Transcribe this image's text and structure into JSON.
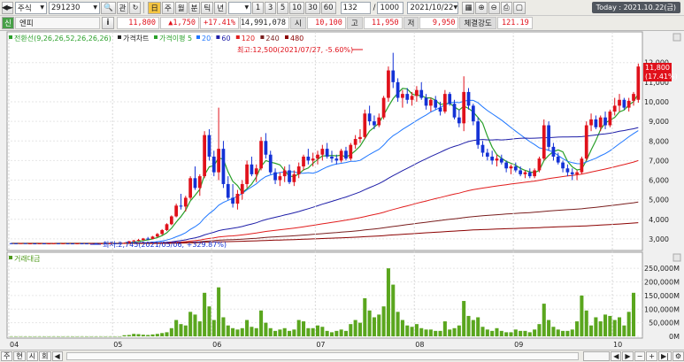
{
  "toolbar": {
    "market_type": "주식",
    "stock_code": "291230",
    "btn_pan": "관",
    "period_buttons": [
      "주",
      "월",
      "분",
      "틱",
      "년"
    ],
    "interval_buttons": [
      "1",
      "3",
      "5",
      "10",
      "30",
      "60"
    ],
    "count_value": "132",
    "total_value": "1000",
    "date_value": "2021/10/22",
    "today_label": "Today : 2021.10.22(금)"
  },
  "quote": {
    "name": "엔피",
    "price": "11,800",
    "change": "▲1,750",
    "change_pct": "+17.41%",
    "volume": "14,991,078",
    "open_label": "시",
    "open": "10,100",
    "high_label": "고",
    "high": "11,950",
    "low_label": "저",
    "low": "9,950",
    "strength_label": "체결강도",
    "strength": "121.19"
  },
  "legend": {
    "ichimoku": "전환선(9,26,26,52,26,26,26)",
    "price_chart": "가격차트",
    "ma_label": "가격이평 5",
    "ma_periods": [
      "20",
      "60",
      "120",
      "240",
      "480"
    ],
    "ma_colors": [
      "#2aa02a",
      "#1f77ff",
      "#1e1ea8",
      "#e11d1d",
      "#7a1e1e",
      "#8b0000"
    ],
    "volume_label": "거래대금"
  },
  "annotations": {
    "high_note": "최고:12,500(2021/07/27, -5.60%)",
    "low_note": "최저:2,745(2021/05/06, +329.87%)",
    "last_price": "11,800",
    "last_pct": "(17.41%)"
  },
  "chart_data": {
    "type": "candlestick",
    "price_axis": [
      "12,000",
      "11,000",
      "10,000",
      "9,000",
      "8,000",
      "7,000",
      "6,000",
      "5,000",
      "4,000",
      "3,000"
    ],
    "price_ylim": [
      2500,
      12800
    ],
    "volume_axis": [
      "250,000M",
      "200,000M",
      "150,000M",
      "100,000M",
      "50,000M",
      "0M"
    ],
    "volume_ylim": [
      0,
      270000
    ],
    "x_ticks": [
      "04",
      "05",
      "06",
      "07",
      "08",
      "09",
      "10"
    ],
    "x_tick_index": [
      0,
      22,
      43,
      65,
      86,
      107,
      128
    ],
    "candles": [
      [
        2780,
        2790,
        2760,
        2775
      ],
      [
        2775,
        2785,
        2760,
        2770
      ],
      [
        2770,
        2790,
        2755,
        2780
      ],
      [
        2780,
        2790,
        2760,
        2765
      ],
      [
        2765,
        2780,
        2750,
        2770
      ],
      [
        2770,
        2785,
        2755,
        2760
      ],
      [
        2760,
        2780,
        2750,
        2772
      ],
      [
        2772,
        2785,
        2755,
        2765
      ],
      [
        2765,
        2780,
        2750,
        2770
      ],
      [
        2770,
        2790,
        2755,
        2775
      ],
      [
        2775,
        2790,
        2760,
        2768
      ],
      [
        2768,
        2785,
        2755,
        2774
      ],
      [
        2774,
        2790,
        2760,
        2770
      ],
      [
        2770,
        2785,
        2755,
        2765
      ],
      [
        2765,
        2780,
        2750,
        2772
      ],
      [
        2772,
        2790,
        2760,
        2770
      ],
      [
        2770,
        2785,
        2755,
        2768
      ],
      [
        2768,
        2780,
        2750,
        2775
      ],
      [
        2775,
        2790,
        2760,
        2770
      ],
      [
        2770,
        2785,
        2755,
        2772
      ],
      [
        2772,
        2790,
        2760,
        2770
      ],
      [
        2770,
        2785,
        2755,
        2775
      ],
      [
        2775,
        2790,
        2760,
        2772
      ],
      [
        2772,
        2785,
        2755,
        2770
      ],
      [
        2770,
        2820,
        2745,
        2800
      ],
      [
        2800,
        2900,
        2780,
        2880
      ],
      [
        2880,
        2950,
        2850,
        2920
      ],
      [
        2920,
        3000,
        2880,
        2950
      ],
      [
        2950,
        3050,
        2900,
        3020
      ],
      [
        3020,
        3100,
        2950,
        3000
      ],
      [
        3000,
        3150,
        2980,
        3120
      ],
      [
        3120,
        3300,
        3080,
        3250
      ],
      [
        3250,
        3500,
        3200,
        3450
      ],
      [
        3450,
        3800,
        3400,
        3750
      ],
      [
        3750,
        4200,
        3700,
        4150
      ],
      [
        4150,
        4800,
        4100,
        4700
      ],
      [
        4700,
        5300,
        4500,
        4650
      ],
      [
        4650,
        5200,
        4400,
        5100
      ],
      [
        5100,
        6200,
        5000,
        6100
      ],
      [
        6100,
        6700,
        5500,
        5600
      ],
      [
        5600,
        6300,
        5200,
        6200
      ],
      [
        6200,
        8500,
        6100,
        8300
      ],
      [
        8300,
        8600,
        7000,
        7200
      ],
      [
        7200,
        7500,
        6200,
        6400
      ],
      [
        6400,
        9700,
        6000,
        7600
      ],
      [
        7600,
        8000,
        5600,
        5800
      ],
      [
        5800,
        6200,
        5000,
        5100
      ],
      [
        5100,
        5800,
        4600,
        4800
      ],
      [
        4800,
        5500,
        4500,
        5300
      ],
      [
        5300,
        6000,
        5000,
        5800
      ],
      [
        5800,
        7000,
        5600,
        6800
      ],
      [
        6800,
        7200,
        6200,
        6300
      ],
      [
        6300,
        6800,
        5900,
        6600
      ],
      [
        6600,
        8200,
        6500,
        8000
      ],
      [
        8000,
        8400,
        7100,
        7300
      ],
      [
        7300,
        7500,
        6300,
        6400
      ],
      [
        6400,
        6600,
        5800,
        6000
      ],
      [
        6000,
        6400,
        5700,
        6200
      ],
      [
        6200,
        6700,
        5900,
        6500
      ],
      [
        6500,
        6800,
        5800,
        5900
      ],
      [
        5900,
        6500,
        5700,
        6300
      ],
      [
        6300,
        6900,
        6100,
        6700
      ],
      [
        6700,
        7300,
        6500,
        7200
      ],
      [
        7200,
        7600,
        6800,
        7000
      ],
      [
        7000,
        7400,
        6700,
        7100
      ],
      [
        7100,
        7500,
        6800,
        7300
      ],
      [
        7300,
        7800,
        7000,
        7600
      ],
      [
        7600,
        7900,
        7100,
        7200
      ],
      [
        7200,
        7500,
        6900,
        7100
      ],
      [
        7100,
        7300,
        6800,
        7000
      ],
      [
        7000,
        7600,
        6900,
        7500
      ],
      [
        7500,
        7700,
        7000,
        7100
      ],
      [
        7100,
        7900,
        7000,
        7800
      ],
      [
        7800,
        8300,
        7600,
        8100
      ],
      [
        8100,
        8600,
        7900,
        8200
      ],
      [
        8200,
        9600,
        8100,
        9400
      ],
      [
        9400,
        9800,
        8800,
        9000
      ],
      [
        9000,
        9300,
        8600,
        8800
      ],
      [
        8800,
        9400,
        8700,
        9200
      ],
      [
        9200,
        10300,
        9100,
        10200
      ],
      [
        10200,
        11800,
        10000,
        11600
      ],
      [
        11600,
        12500,
        10700,
        11000
      ],
      [
        11000,
        11200,
        10000,
        10200
      ],
      [
        10200,
        10600,
        9700,
        10400
      ],
      [
        10400,
        10700,
        9900,
        10100
      ],
      [
        10100,
        10500,
        9800,
        10300
      ],
      [
        10300,
        10800,
        10000,
        10600
      ],
      [
        10600,
        11000,
        10100,
        10200
      ],
      [
        10200,
        10400,
        9600,
        9800
      ],
      [
        9800,
        10200,
        9500,
        10100
      ],
      [
        10100,
        10300,
        9600,
        9700
      ],
      [
        9700,
        10000,
        9300,
        9500
      ],
      [
        9500,
        10600,
        9400,
        10400
      ],
      [
        10400,
        10500,
        9800,
        9900
      ],
      [
        9900,
        10100,
        9100,
        9200
      ],
      [
        9200,
        9600,
        8700,
        8900
      ],
      [
        8900,
        11300,
        8500,
        10500
      ],
      [
        10500,
        10700,
        9600,
        9800
      ],
      [
        9800,
        9900,
        8800,
        9000
      ],
      [
        9000,
        9200,
        7600,
        7800
      ],
      [
        7800,
        8000,
        7200,
        7400
      ],
      [
        7400,
        7600,
        7000,
        7200
      ],
      [
        7200,
        7500,
        6800,
        7000
      ],
      [
        7000,
        7300,
        6700,
        7100
      ],
      [
        7100,
        7300,
        6800,
        6900
      ],
      [
        6900,
        7000,
        6400,
        6600
      ],
      [
        6600,
        6800,
        6300,
        6700
      ],
      [
        6700,
        6900,
        6400,
        6500
      ],
      [
        6500,
        6700,
        6200,
        6300
      ],
      [
        6300,
        6500,
        6100,
        6400
      ],
      [
        6400,
        6600,
        6100,
        6200
      ],
      [
        6200,
        6600,
        6100,
        6500
      ],
      [
        6500,
        7200,
        6400,
        7100
      ],
      [
        7100,
        9100,
        7000,
        8800
      ],
      [
        8800,
        9000,
        7500,
        7700
      ],
      [
        7700,
        7900,
        7000,
        7200
      ],
      [
        7200,
        7400,
        6800,
        6900
      ],
      [
        6900,
        7000,
        6400,
        6600
      ],
      [
        6600,
        6800,
        6200,
        6400
      ],
      [
        6400,
        6600,
        6000,
        6300
      ],
      [
        6300,
        6500,
        6000,
        6400
      ],
      [
        6400,
        7200,
        6300,
        7100
      ],
      [
        7100,
        9000,
        7000,
        8800
      ],
      [
        8800,
        9400,
        8500,
        9100
      ],
      [
        9100,
        9300,
        8600,
        8700
      ],
      [
        8700,
        9300,
        8500,
        9200
      ],
      [
        9200,
        9500,
        8600,
        8800
      ],
      [
        8800,
        9600,
        8700,
        9500
      ],
      [
        9500,
        10200,
        9300,
        9800
      ],
      [
        9800,
        10400,
        9500,
        10100
      ],
      [
        10100,
        10200,
        9600,
        9700
      ],
      [
        9700,
        10200,
        9500,
        10050
      ],
      [
        10050,
        10500,
        9800,
        10400
      ],
      [
        10100,
        11950,
        9950,
        11800
      ]
    ],
    "volumes": [
      300,
      200,
      300,
      200,
      200,
      200,
      300,
      200,
      200,
      300,
      200,
      200,
      300,
      200,
      200,
      300,
      200,
      200,
      200,
      300,
      200,
      300,
      200,
      200,
      4000,
      5000,
      9000,
      8000,
      6000,
      5000,
      7000,
      9000,
      12000,
      15000,
      30000,
      60000,
      45000,
      40000,
      90000,
      80000,
      55000,
      160000,
      110000,
      60000,
      180000,
      70000,
      40000,
      30000,
      25000,
      30000,
      60000,
      35000,
      30000,
      95000,
      50000,
      30000,
      20000,
      25000,
      30000,
      20000,
      25000,
      60000,
      55000,
      30000,
      30000,
      40000,
      35000,
      20000,
      15000,
      20000,
      25000,
      20000,
      45000,
      60000,
      50000,
      140000,
      95000,
      70000,
      80000,
      110000,
      250000,
      190000,
      90000,
      60000,
      40000,
      35000,
      45000,
      30000,
      25000,
      25000,
      20000,
      20000,
      55000,
      25000,
      30000,
      40000,
      130000,
      75000,
      60000,
      70000,
      35000,
      25000,
      20000,
      30000,
      20000,
      15000,
      15000,
      25000,
      20000,
      20000,
      15000,
      25000,
      45000,
      120000,
      60000,
      35000,
      25000,
      20000,
      20000,
      25000,
      55000,
      150000,
      95000,
      40000,
      70000,
      55000,
      80000,
      75000,
      60000,
      70000,
      40000,
      90000,
      160000
    ],
    "ma_series": [
      {
        "name": "5",
        "values": []
      },
      {
        "name": "20",
        "values": []
      },
      {
        "name": "60",
        "values": []
      },
      {
        "name": "120",
        "values": []
      },
      {
        "name": "240",
        "values": []
      },
      {
        "name": "480",
        "values": []
      }
    ]
  },
  "bottom": {
    "tabs": [
      "주",
      "현",
      "시",
      "회"
    ]
  }
}
